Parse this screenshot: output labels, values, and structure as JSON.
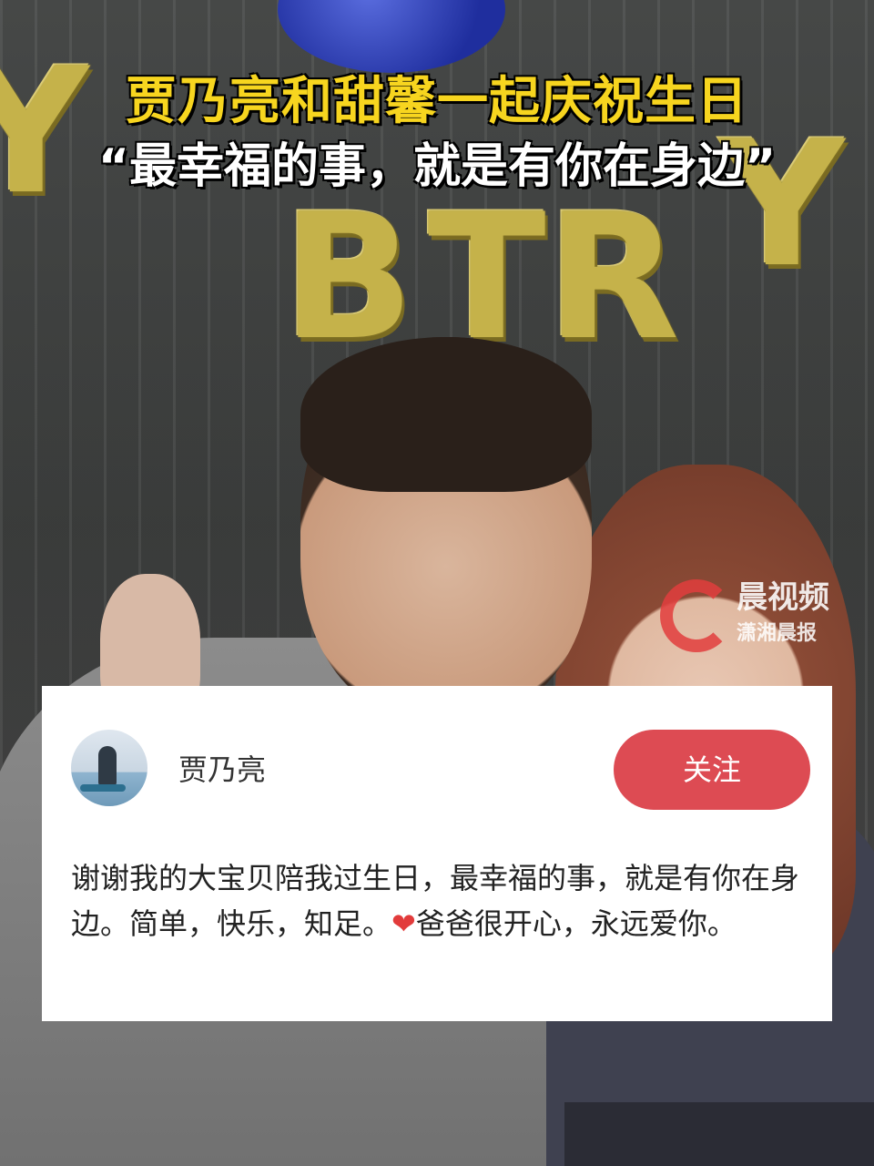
{
  "headline": {
    "line1": "贾乃亮和甜馨一起庆祝生日",
    "line2": "“最幸福的事，就是有你在身边”"
  },
  "balloons": {
    "letters": [
      "Y",
      "B",
      "T",
      "R",
      "Y"
    ]
  },
  "watermark": {
    "brand": "晨视频",
    "sub": "潇湘晨报"
  },
  "post": {
    "username": "贾乃亮",
    "follow_label": "关注",
    "text_before_heart": "谢谢我的大宝贝陪我过生日，最幸福的事，就是有你在身边。简单，快乐，知足。",
    "heart_icon": "heart-icon",
    "text_after_heart": "爸爸很开心，永远爱你。"
  },
  "colors": {
    "headline_yellow": "#f7d51f",
    "follow_button": "#dd4b53",
    "heart": "#e23b3b"
  }
}
